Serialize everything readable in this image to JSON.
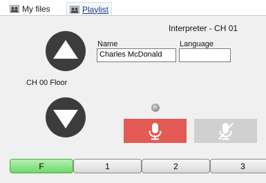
{
  "tabs": [
    {
      "label": "My files",
      "icon": "group-icon"
    },
    {
      "label": "Playlist",
      "icon": "group-icon"
    }
  ],
  "panel": {
    "title": "Interpreter - CH 01",
    "channel_floor_label": "CH 00  Floor",
    "name_label": "Name",
    "name_value": "Charles McDonald",
    "language_label": "Language",
    "language_value": ""
  },
  "colors": {
    "mic_active": "#e45a55",
    "mic_mute": "#d0d0d0",
    "floor_button": "#6fd96a",
    "arrow_button": "#3c3c3c"
  },
  "channels": [
    {
      "label": "F",
      "active": true
    },
    {
      "label": "1",
      "active": false
    },
    {
      "label": "2",
      "active": false
    },
    {
      "label": "3",
      "active": false
    }
  ]
}
